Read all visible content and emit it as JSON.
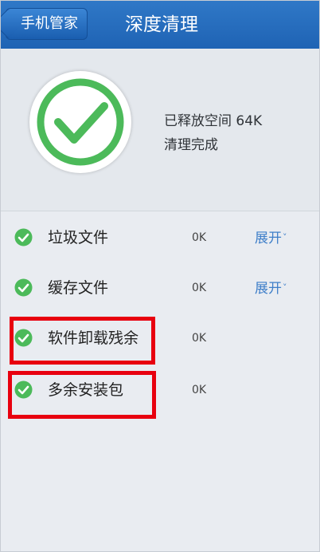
{
  "header": {
    "back_label": "手机管家",
    "title": "深度清理"
  },
  "summary": {
    "freed_label": "已释放空间 64K",
    "status_label": "清理完成",
    "check_color": "#4cba5a"
  },
  "items": [
    {
      "label": "垃圾文件",
      "size": "0K",
      "expand_label": "展开",
      "checked": true
    },
    {
      "label": "缓存文件",
      "size": "0K",
      "expand_label": "展开",
      "checked": true
    },
    {
      "label": "软件卸载残余",
      "size": "0K",
      "checked": true
    },
    {
      "label": "多余安装包",
      "size": "0K",
      "checked": true
    }
  ],
  "colors": {
    "header": "#1f63b4",
    "accent_link": "#3f7fc9",
    "highlight": "#e8000f",
    "check": "#4cba5a"
  }
}
